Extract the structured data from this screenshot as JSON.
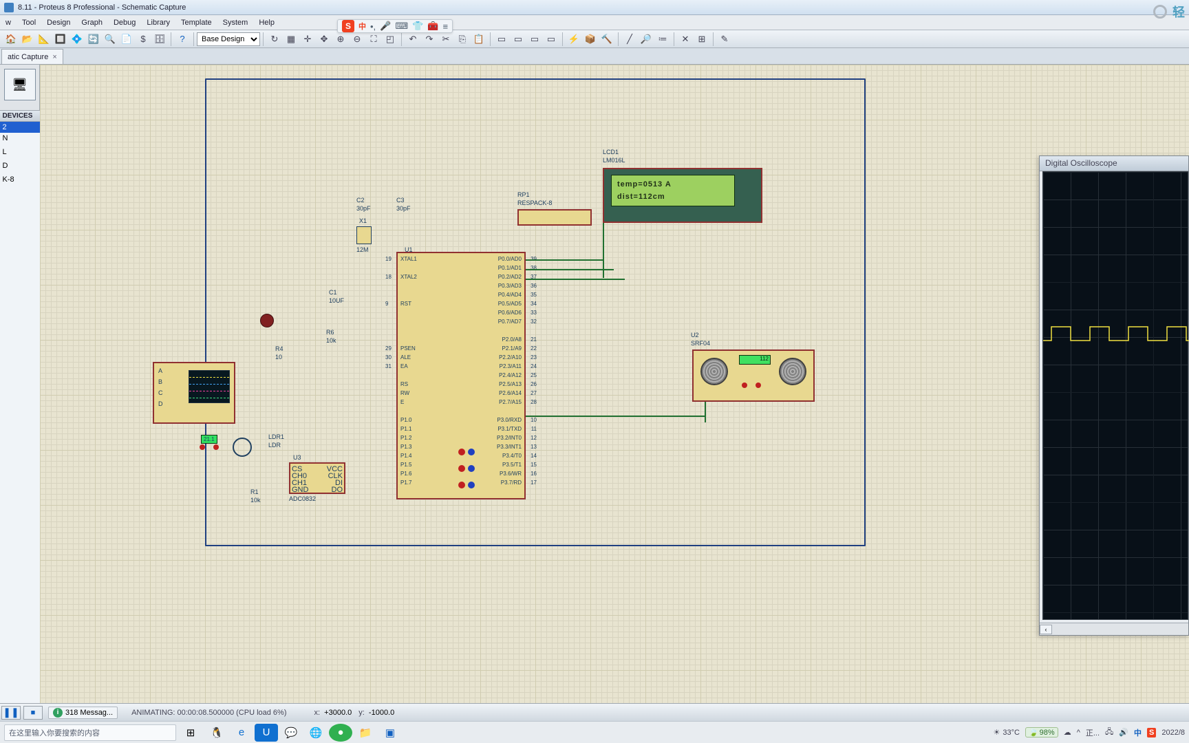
{
  "title": "8.11 - Proteus 8 Professional - Schematic Capture",
  "menus": [
    "w",
    "Tool",
    "Design",
    "Graph",
    "Debug",
    "Library",
    "Template",
    "System",
    "Help"
  ],
  "design_select": "Base Design",
  "tab_label": "atic Capture",
  "devices_header": "DEVICES",
  "devices_rows": [
    "2",
    "N",
    "",
    "L",
    "",
    "D",
    "",
    "K-8"
  ],
  "lcd": {
    "ref": "LCD1",
    "part": "LM016L",
    "line1": "temp=0513   A",
    "line2": "dist=112cm"
  },
  "mcu": {
    "ref": "U1",
    "pins_left": [
      "XTAL1",
      "",
      "XTAL2",
      "",
      "",
      "RST",
      "",
      "",
      "",
      "",
      "PSEN",
      "ALE",
      "EA",
      "",
      "RS",
      "RW",
      "E",
      "",
      "P1.0",
      "P1.1",
      "P1.2",
      "P1.3",
      "P1.4",
      "P1.5",
      "P1.6",
      "P1.7"
    ],
    "pins_right": [
      "P0.0/AD0",
      "P0.1/AD1",
      "P0.2/AD2",
      "P0.3/AD3",
      "P0.4/AD4",
      "P0.5/AD5",
      "P0.6/AD6",
      "P0.7/AD7",
      "",
      "P2.0/A8",
      "P2.1/A9",
      "P2.2/A10",
      "P2.3/A11",
      "P2.4/A12",
      "P2.5/A13",
      "P2.6/A14",
      "P2.7/A15",
      "",
      "P3.0/RXD",
      "P3.1/TXD",
      "P3.2/INT0",
      "P3.3/INT1",
      "P3.4/T0",
      "P3.5/T1",
      "P3.6/WR",
      "P3.7/RD"
    ],
    "nums_left": [
      "19",
      "",
      "18",
      "",
      "",
      "9",
      "",
      "",
      "",
      "",
      "29",
      "30",
      "31"
    ],
    "nums_right": [
      "39",
      "38",
      "37",
      "36",
      "35",
      "34",
      "33",
      "32",
      "",
      "21",
      "22",
      "23",
      "24",
      "25",
      "26",
      "27",
      "28",
      "",
      "10",
      "11",
      "12",
      "13",
      "14",
      "15",
      "16",
      "17"
    ]
  },
  "rp1": {
    "ref": "RP1",
    "part": "RESPACK-8"
  },
  "c1": {
    "ref": "C1",
    "val": "10UF"
  },
  "c2": {
    "ref": "C2",
    "val": "30pF"
  },
  "c3": {
    "ref": "C3",
    "val": "30pF"
  },
  "x1": {
    "ref": "X1",
    "val": "12M"
  },
  "r4": {
    "ref": "R4",
    "val": "10"
  },
  "r6": {
    "ref": "R6",
    "val": "10k"
  },
  "r1": {
    "ref": "R1",
    "val": "10k"
  },
  "ldr": {
    "ref": "LDR1",
    "part": "LDR"
  },
  "u2": {
    "ref": "U2",
    "part": "SRF04",
    "value": "112"
  },
  "u3": {
    "ref": "U3",
    "part": "ADC0832",
    "pins": [
      "CS",
      "CH0",
      "CH1",
      "GND",
      "VCC",
      "CLK",
      "DI",
      "DO"
    ]
  },
  "ldr_badge": "21.1",
  "osc_title": "Digital Oscilloscope",
  "status": {
    "messages": "318 Messag...",
    "anim": "ANIMATING: 00:00:08.500000 (CPU load 6%)",
    "coord_x": "+3000.0",
    "coord_y": "-1000.0"
  },
  "taskbar": {
    "search_placeholder": "在这里输入你要搜索的内容",
    "temp": "33°C",
    "battery": "98%",
    "ime": "正...",
    "date": "2022/8"
  },
  "ime": {
    "lang": "中"
  },
  "win_hint": "轻"
}
